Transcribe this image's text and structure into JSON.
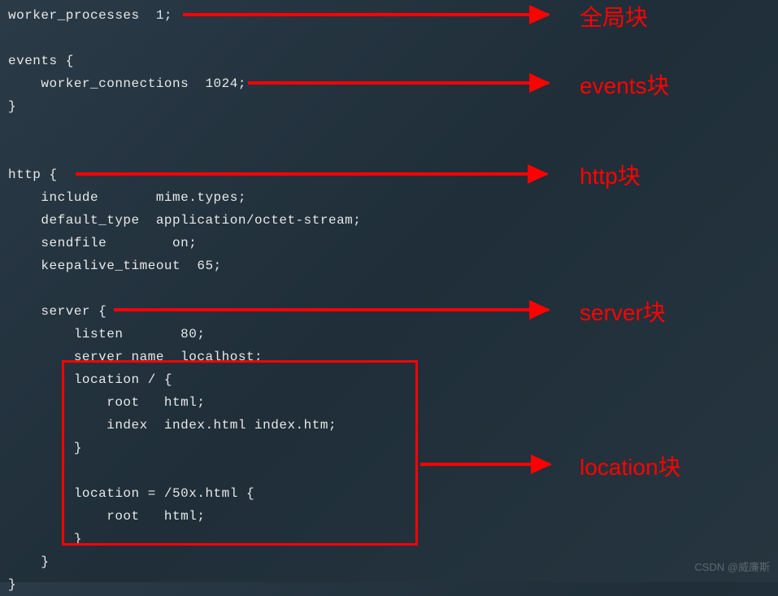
{
  "code": {
    "line1": "worker_processes  1;",
    "line2": "",
    "line3": "events {",
    "line4": "    worker_connections  1024;",
    "line5": "}",
    "line6": "",
    "line7": "",
    "line8": "http {",
    "line9": "    include       mime.types;",
    "line10": "    default_type  application/octet-stream;",
    "line11": "    sendfile        on;",
    "line12": "    keepalive_timeout  65;",
    "line13": "",
    "line14": "    server {",
    "line15": "        listen       80;",
    "line16": "        server_name  localhost;",
    "line17": "        location / {",
    "line18": "            root   html;",
    "line19": "            index  index.html index.htm;",
    "line20": "        }",
    "line21": "",
    "line22": "        location = /50x.html {",
    "line23": "            root   html;",
    "line24": "        }",
    "line25": "    }",
    "line26": "}"
  },
  "labels": {
    "global": "全局块",
    "events": "events块",
    "http": "http块",
    "server": "server块",
    "location": "location块"
  },
  "watermark": "CSDN @威廉斯"
}
